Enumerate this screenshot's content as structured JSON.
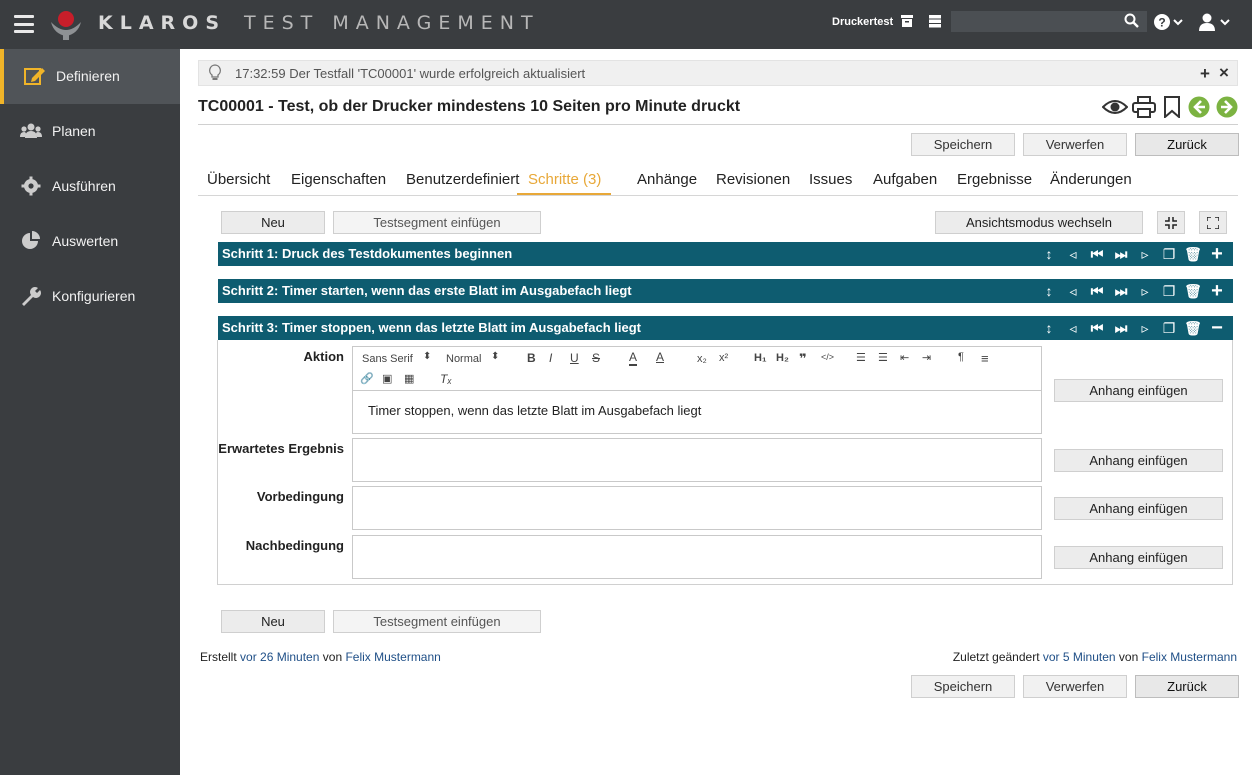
{
  "app": {
    "brand_name": "KLAROS",
    "brand_sub": "TEST MANAGEMENT",
    "project": "Druckertest",
    "search_placeholder": ""
  },
  "sidebar": {
    "items": [
      {
        "label": "Definieren",
        "icon": "edit-icon",
        "active": true
      },
      {
        "label": "Planen",
        "icon": "users-icon"
      },
      {
        "label": "Ausführen",
        "icon": "gear-icon"
      },
      {
        "label": "Auswerten",
        "icon": "pie-chart-icon"
      },
      {
        "label": "Konfigurieren",
        "icon": "wrench-icon"
      }
    ]
  },
  "notice": {
    "text": "17:32:59 Der Testfall 'TC00001' wurde erfolgreich aktualisiert"
  },
  "page": {
    "title": "TC00001 - Test, ob der Drucker mindestens 10 Seiten pro Minute druckt"
  },
  "actions": {
    "save": "Speichern",
    "discard": "Verwerfen",
    "back": "Zurück"
  },
  "tabs": [
    "Übersicht",
    "Eigenschaften",
    "Benutzerdefiniert",
    "Schritte (3)",
    "Anhänge",
    "Revisionen",
    "Issues",
    "Aufgaben",
    "Ergebnisse",
    "Änderungen"
  ],
  "steps_toolbar": {
    "new": "Neu",
    "insert_segment": "Testsegment einfügen",
    "toggle_view": "Ansichtsmodus wechseln"
  },
  "steps": [
    {
      "label": "Schritt 1: Druck des Testdokumentes beginnen"
    },
    {
      "label": "Schritt 2: Timer starten, wenn das erste Blatt im Ausgabefach liegt"
    },
    {
      "label": "Schritt 3: Timer stoppen, wenn das letzte Blatt im Ausgabefach liegt"
    }
  ],
  "step_form": {
    "action_label": "Aktion",
    "expected_label": "Erwartetes Ergebnis",
    "pre_label": "Vorbedingung",
    "post_label": "Nachbedingung",
    "action_text": "Timer stoppen, wenn das letzte Blatt im Ausgabefach liegt",
    "attach": "Anhang einfügen",
    "font": "Sans Serif",
    "size": "Normal"
  },
  "footer": {
    "created_prefix": "Erstellt",
    "created_time": "vor 26 Minuten",
    "by": "von",
    "created_user": "Felix Mustermann",
    "changed_prefix": "Zuletzt geändert",
    "changed_time": "vor 5 Minuten",
    "changed_user": "Felix Mustermann"
  },
  "colors": {
    "topbar": "#3a3d40",
    "accent": "#f0b429",
    "step_header": "#0e5c70",
    "tab_active": "#e8a838",
    "nav_green": "#7cb342"
  }
}
